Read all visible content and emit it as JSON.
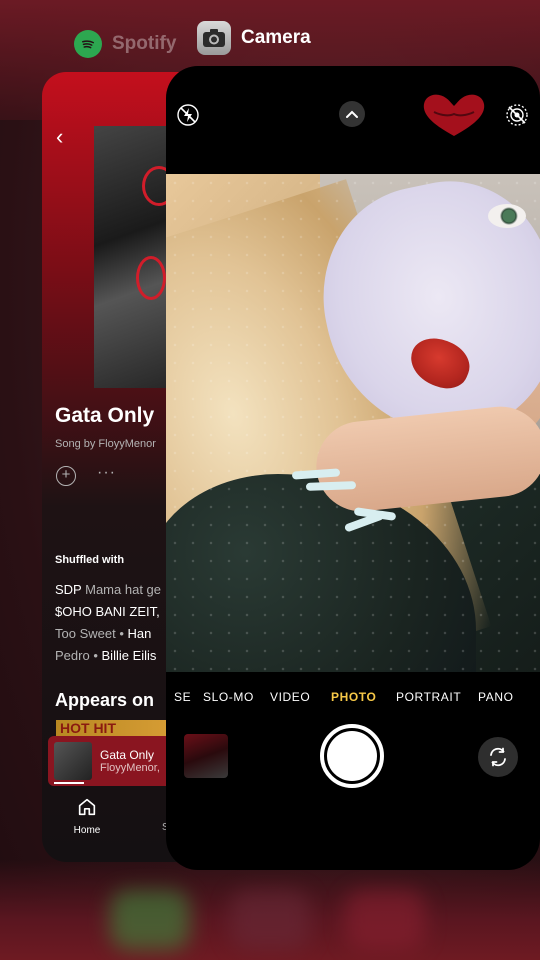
{
  "switcher": {
    "spotify_label": "Spotify",
    "camera_label": "Camera"
  },
  "spotify": {
    "track_title": "Gata Only",
    "track_subtitle": "Song by FloyyMenor",
    "shuffled_with_label": "Shuffled with",
    "shuffled_lines": [
      {
        "a": "SDP",
        "b": "Mama hat ge"
      },
      {
        "a": "$OHO BANI",
        "b": "ZEIT,"
      },
      {
        "a": "Too Sweet",
        "sep": "•",
        "b": "Han"
      },
      {
        "a": "Pedro",
        "sep": "•",
        "b": "Billie Eilis"
      }
    ],
    "appears_on_label": "Appears on",
    "appears_thumb_text": "HOT HIT",
    "now_playing": {
      "title": "Gata Only",
      "artist": "FloyyMenor,"
    },
    "nav": {
      "home_label": "Home",
      "second_label": "S"
    }
  },
  "camera": {
    "modes": [
      {
        "label": "SE",
        "state": "inactive"
      },
      {
        "label": "SLO-MO",
        "state": "inactive"
      },
      {
        "label": "VIDEO",
        "state": "inactive"
      },
      {
        "label": "PHOTO",
        "state": "active"
      },
      {
        "label": "PORTRAIT",
        "state": "inactive"
      },
      {
        "label": "PANO",
        "state": "inactive"
      }
    ],
    "icons": {
      "flash": "flash-off-icon",
      "chevron": "chevron-up-icon",
      "live": "live-photo-off-icon",
      "flip": "camera-flip-icon"
    },
    "active_mode_color": "#f7c948"
  },
  "colors": {
    "spotify_green": "#1ed760",
    "spotify_red": "#c40f1d"
  }
}
